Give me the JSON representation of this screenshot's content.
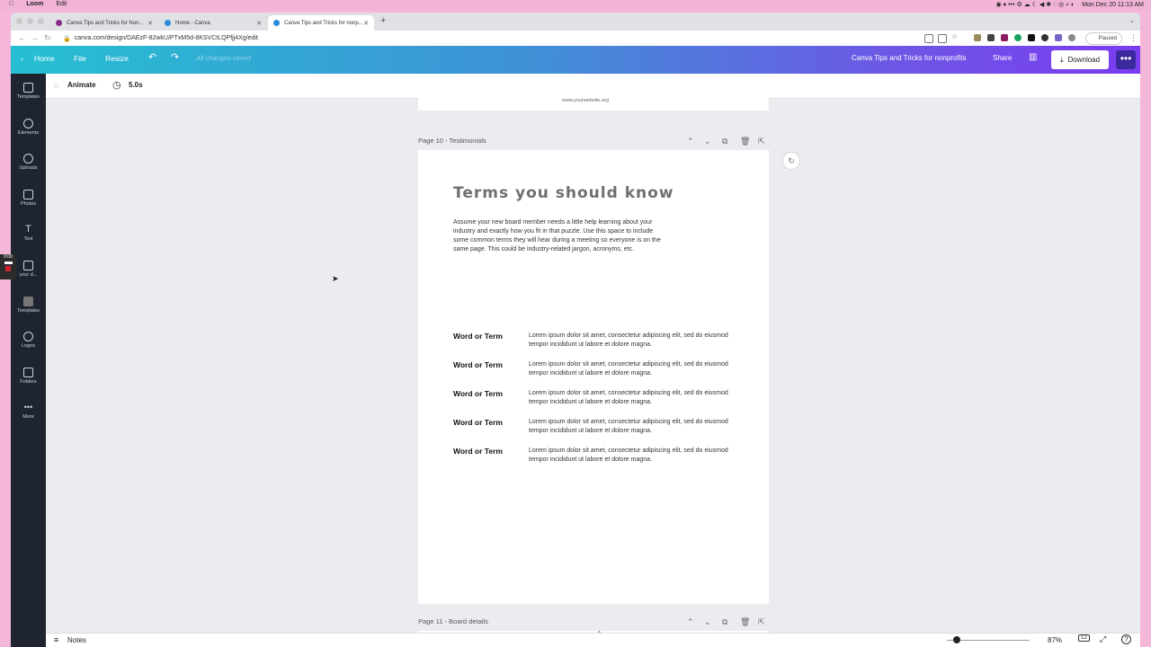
{
  "menubar": {
    "app": "Loom",
    "edit": "Edit",
    "datetime": "Mon Dec 20  11:13 AM"
  },
  "browser": {
    "tabs": [
      {
        "label": "Canva Tips and Tricks for Non..."
      },
      {
        "label": "Home - Canva"
      },
      {
        "label": "Canva Tips and Tricks for nonp..."
      }
    ],
    "url": "canva.com/design/DAEzF-82wkU/PTxM5d-8KSVCtLQPfjj4Xg/edit",
    "paused_label": "Paused"
  },
  "header": {
    "home": "Home",
    "file": "File",
    "resize": "Resize",
    "saved_status": "All changes saved",
    "design_title": "Canva Tips and Tricks for nonprofits",
    "share": "Share",
    "download": "Download"
  },
  "sidebar": {
    "items": [
      {
        "label": "Templates"
      },
      {
        "label": "Elements"
      },
      {
        "label": "Uploads"
      },
      {
        "label": "Photos"
      },
      {
        "label": "Text"
      },
      {
        "label": "your d..."
      },
      {
        "label": "Templates"
      },
      {
        "label": "Logos"
      },
      {
        "label": "Folders"
      },
      {
        "label": "More"
      }
    ]
  },
  "recorder": {
    "time": "0:00"
  },
  "editor": {
    "animate": "Animate",
    "duration": "5.0s",
    "prev_page_footer": "www.yourwebsite.org",
    "page10_label": "Page 10 - Testimonials",
    "page11_label": "Page 11 - Board details",
    "page": {
      "title": "Terms you should know",
      "intro": "Assume your new board member needs a little help learning about your industry and exactly how you fit in that puzzle. Use this space to include some common terms they will hear during a meeting so everyone is on the same page. This could be industry-related jargon, acronyms, etc.",
      "terms": [
        {
          "word": "Word or Term",
          "definition": "Lorem ipsum dolor sit amet, consectetur adipiscing elit, sed do eiusmod tempor incididunt ut labore et dolore magna."
        },
        {
          "word": "Word or Term",
          "definition": "Lorem ipsum dolor sit amet, consectetur adipiscing elit, sed do eiusmod tempor incididunt ut labore et dolore magna."
        },
        {
          "word": "Word or Term",
          "definition": "Lorem ipsum dolor sit amet, consectetur adipiscing elit, sed do eiusmod tempor incididunt ut labore et dolore magna."
        },
        {
          "word": "Word or Term",
          "definition": "Lorem ipsum dolor sit amet, consectetur adipiscing elit, sed do eiusmod tempor incididunt ut labore et dolore magna."
        },
        {
          "word": "Word or Term",
          "definition": "Lorem ipsum dolor sit amet, consectetur adipiscing elit, sed do eiusmod tempor incididunt ut labore et dolore magna."
        }
      ]
    }
  },
  "bottom": {
    "notes": "Notes",
    "zoom": "87%",
    "page_count": "12"
  },
  "colors": {
    "header_start": "#26bfd2",
    "header_end": "#7a3cf0",
    "sidebar": "#1e2530",
    "canvas_bg": "#ebecf0"
  }
}
